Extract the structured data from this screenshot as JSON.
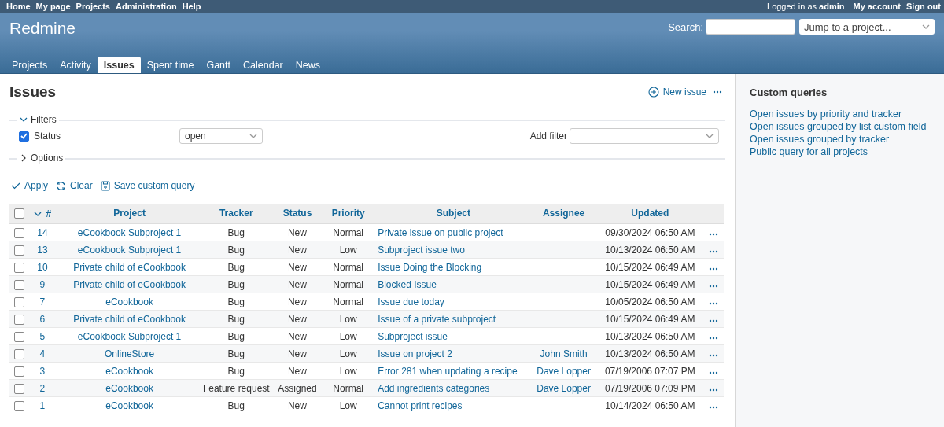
{
  "top_menu": [
    "Home",
    "My page",
    "Projects",
    "Administration",
    "Help"
  ],
  "account": {
    "logged_in": "Logged in as **admin**",
    "links": [
      "My account",
      "Sign out"
    ]
  },
  "header": {
    "title": "Redmine",
    "search_label": "Search:",
    "project_jump": {
      "placeholder": "Jump to a project..."
    }
  },
  "tabs": [
    {
      "label": "Projects",
      "selected": false
    },
    {
      "label": "Activity",
      "selected": false
    },
    {
      "label": "Issues",
      "selected": true
    },
    {
      "label": "Spent time",
      "selected": false
    },
    {
      "label": "Gantt",
      "selected": false
    },
    {
      "label": "Calendar",
      "selected": false
    },
    {
      "label": "News",
      "selected": false
    }
  ],
  "content": {
    "title": "Issues",
    "new_issue": "New issue",
    "filters": {
      "label": "Filters",
      "expanded": true,
      "rows": [
        {
          "label": "Status",
          "checked": true,
          "value": "open"
        }
      ],
      "add_filter": "Add filter"
    },
    "options": {
      "label": "Options",
      "expanded": false
    },
    "actions": [
      {
        "kind": "apply",
        "label": "Apply"
      },
      {
        "kind": "clear",
        "label": "Clear"
      },
      {
        "kind": "save",
        "label": "Save custom query"
      }
    ]
  },
  "table": {
    "select_all_checked": false,
    "columns": [
      "#",
      "Project",
      "Tracker",
      "Status",
      "Priority",
      "Subject",
      "Assignee",
      "Updated"
    ],
    "rows": [
      {
        "selected": false,
        "cells": [
          "14",
          "eCookbook Subproject 1",
          "Bug",
          "New",
          "Normal",
          "Private issue on public project",
          "",
          "09/30/2024 06:50 AM"
        ]
      },
      {
        "selected": false,
        "cells": [
          "13",
          "eCookbook Subproject 1",
          "Bug",
          "New",
          "Low",
          "Subproject issue two",
          "",
          "10/13/2024 06:50 AM"
        ]
      },
      {
        "selected": false,
        "cells": [
          "10",
          "Private child of eCookbook",
          "Bug",
          "New",
          "Normal",
          "Issue Doing the Blocking",
          "",
          "10/15/2024 06:49 AM"
        ]
      },
      {
        "selected": false,
        "cells": [
          "9",
          "Private child of eCookbook",
          "Bug",
          "New",
          "Normal",
          "Blocked Issue",
          "",
          "10/15/2024 06:49 AM"
        ]
      },
      {
        "selected": false,
        "cells": [
          "7",
          "eCookbook",
          "Bug",
          "New",
          "Normal",
          "Issue due today",
          "",
          "10/05/2024 06:50 AM"
        ]
      },
      {
        "selected": false,
        "cells": [
          "6",
          "Private child of eCookbook",
          "Bug",
          "New",
          "Low",
          "Issue of a private subproject",
          "",
          "10/15/2024 06:49 AM"
        ]
      },
      {
        "selected": false,
        "cells": [
          "5",
          "eCookbook Subproject 1",
          "Bug",
          "New",
          "Low",
          "Subproject issue",
          "",
          "10/13/2024 06:50 AM"
        ]
      },
      {
        "selected": false,
        "cells": [
          "4",
          "OnlineStore",
          "Bug",
          "New",
          "Low",
          "Issue on project 2",
          "John Smith",
          "10/13/2024 06:50 AM"
        ]
      },
      {
        "selected": false,
        "cells": [
          "3",
          "eCookbook",
          "Bug",
          "New",
          "Low",
          "Error 281 when updating a recipe",
          "Dave Lopper",
          "07/19/2006 07:07 PM"
        ]
      },
      {
        "selected": false,
        "cells": [
          "2",
          "eCookbook",
          "Feature request",
          "Assigned",
          "Normal",
          "Add ingredients categories",
          "Dave Lopper",
          "07/19/2006 07:09 PM"
        ]
      },
      {
        "selected": false,
        "cells": [
          "1",
          "eCookbook",
          "Bug",
          "New",
          "Low",
          "Cannot print recipes",
          "",
          "10/14/2024 06:50 AM"
        ]
      }
    ]
  },
  "sidebar": {
    "title": "Custom queries",
    "links": [
      "Open issues by priority and tracker",
      "Open issues grouped by list custom field",
      "Open issues grouped by tracker",
      "Public query for all projects"
    ]
  }
}
